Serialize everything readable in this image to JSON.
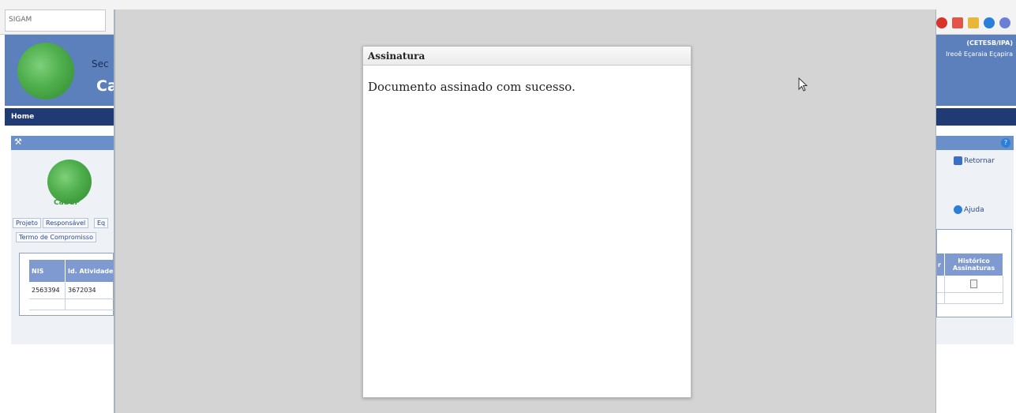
{
  "app": {
    "system_label": "SIGAM"
  },
  "header": {
    "title_partial_1": "Sec",
    "title_partial_2": "Ca",
    "org": "(CETESB/IPA)",
    "user": "Ireoê Eçaraia Eçapira"
  },
  "nav": {
    "home": "Home"
  },
  "module": {
    "logo_caption": "CadGP"
  },
  "tabs": [
    "Projeto",
    "Responsável",
    "Eq"
  ],
  "subtab": "Termo de Compromisso",
  "table": {
    "headers": {
      "nis": "NIS",
      "id_atividade": "Id. Atividade",
      "partial": "r",
      "historico": "Histórico Assinaturas"
    },
    "rows": [
      {
        "nis": "2563394",
        "id_atividade": "3672034"
      }
    ]
  },
  "actions": {
    "retornar": "Retornar",
    "ajuda": "Ajuda"
  },
  "dialog": {
    "title": "Assinatura",
    "message": "Documento assinado com sucesso."
  },
  "icons": {
    "toolbar": [
      "close-icon",
      "home-icon",
      "edit-icon",
      "help-icon",
      "user-icon"
    ],
    "colors": {
      "header_blue": "#5b80bc",
      "nav_navy": "#203a73",
      "logo_green": "#4fae4c",
      "overlay_gray": "#d4d4d4"
    }
  }
}
